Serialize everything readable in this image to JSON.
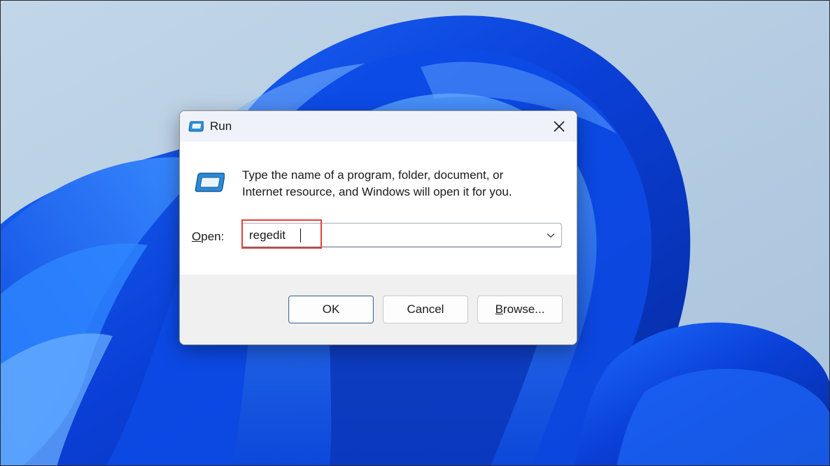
{
  "dialog": {
    "title": "Run",
    "description_line1": "Type the name of a program, folder, document, or",
    "description_line2": "Internet resource, and Windows will open it for you.",
    "open_label_accel": "O",
    "open_label_rest": "pen:",
    "open_value": "regedit",
    "buttons": {
      "ok": "OK",
      "cancel": "Cancel",
      "browse_accel": "B",
      "browse_rest": "rowse..."
    }
  },
  "icons": {
    "title_icon": "run-icon",
    "app_icon": "run-icon",
    "close": "close-icon",
    "dropdown": "chevron-down-icon"
  },
  "colors": {
    "highlight": "#e3413c",
    "accent": "#1a5fe0"
  }
}
